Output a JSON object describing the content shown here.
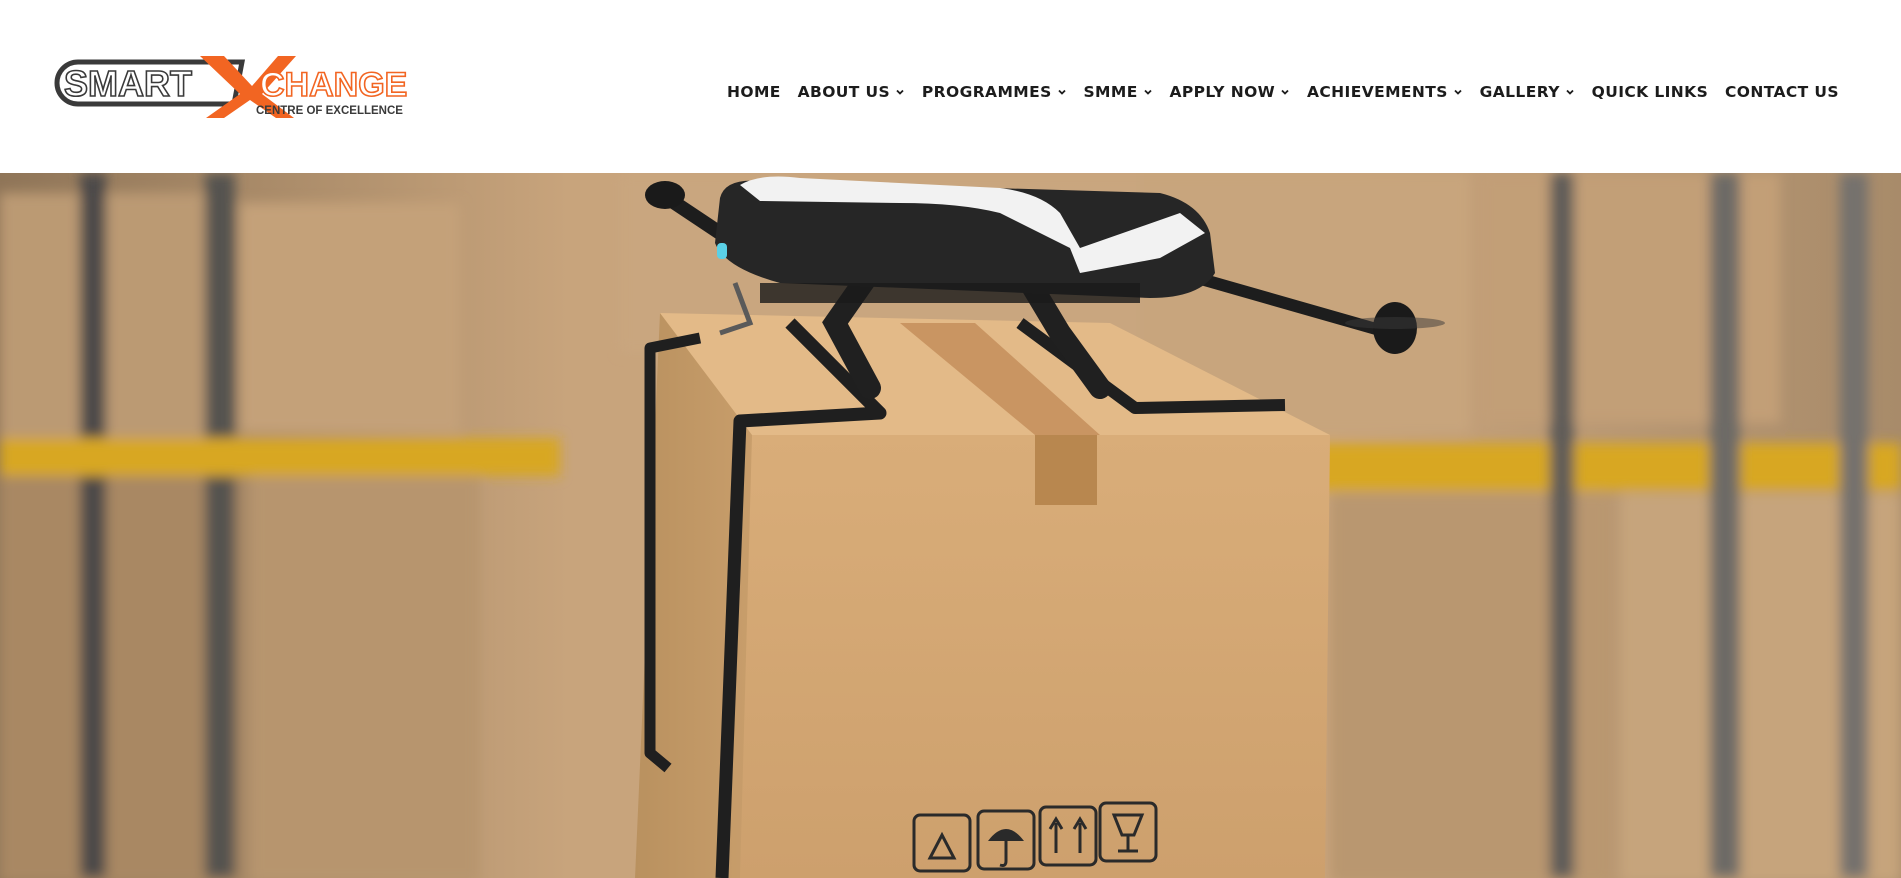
{
  "logo": {
    "wordmark_left": "SMART",
    "wordmark_x": "X",
    "wordmark_right": "CHANGE",
    "tagline": "CENTRE OF EXCELLENCE",
    "colors": {
      "dark": "#3a3a3a",
      "orange": "#f26522"
    }
  },
  "nav": {
    "items": [
      {
        "label": "HOME",
        "dropdown": false
      },
      {
        "label": "ABOUT US",
        "dropdown": true
      },
      {
        "label": "PROGRAMMES",
        "dropdown": true
      },
      {
        "label": "SMME",
        "dropdown": true
      },
      {
        "label": "APPLY NOW",
        "dropdown": true
      },
      {
        "label": "ACHIEVEMENTS",
        "dropdown": true
      },
      {
        "label": "GALLERY",
        "dropdown": true
      },
      {
        "label": "QUICK LINKS",
        "dropdown": false
      },
      {
        "label": "CONTACT US",
        "dropdown": false
      }
    ],
    "text_color": "#1c1c1c"
  },
  "hero": {
    "image_subject": "drone-carrying-cardboard-box-in-warehouse",
    "colors": {
      "box": "#d4a873",
      "shelf_yellow": "#d8a722",
      "drone_body": "#262626",
      "drone_cover": "#f2f2f2"
    }
  }
}
